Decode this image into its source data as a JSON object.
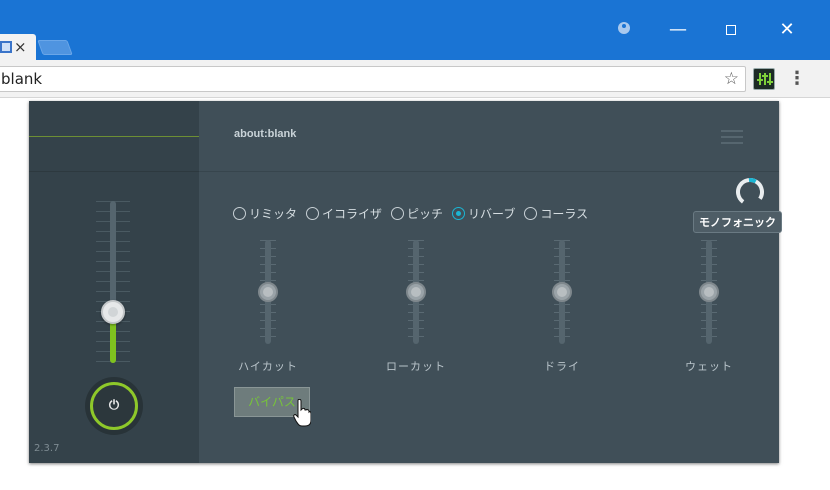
{
  "browser": {
    "url": "blank",
    "tab_close": "×",
    "icons": {
      "star": "star-icon",
      "menu": "more-vert-icon",
      "profile": "account-circle-icon",
      "extension": "equalizer-icon"
    }
  },
  "window": {
    "minimize": "—",
    "close": "✕"
  },
  "popup": {
    "title": "about:blank",
    "mono_label": "モノフォニック",
    "effects": [
      {
        "label": "リミッタ",
        "selected": false
      },
      {
        "label": "イコライザ",
        "selected": false
      },
      {
        "label": "ピッチ",
        "selected": false
      },
      {
        "label": "リバーブ",
        "selected": true
      },
      {
        "label": "コーラス",
        "selected": false
      }
    ],
    "sliders": [
      {
        "label": "ハイカット",
        "value": 0.5
      },
      {
        "label": "ローカット",
        "value": 0.5
      },
      {
        "label": "ドライ",
        "value": 0.5
      },
      {
        "label": "ウェット",
        "value": 0.5
      }
    ],
    "volume_level": 0.28,
    "power_symbol": "⏻",
    "bypass_label": "バイパス",
    "version": "2.3.7",
    "accent_color": "#7fc21f",
    "radio_color": "#1bb6d4"
  }
}
